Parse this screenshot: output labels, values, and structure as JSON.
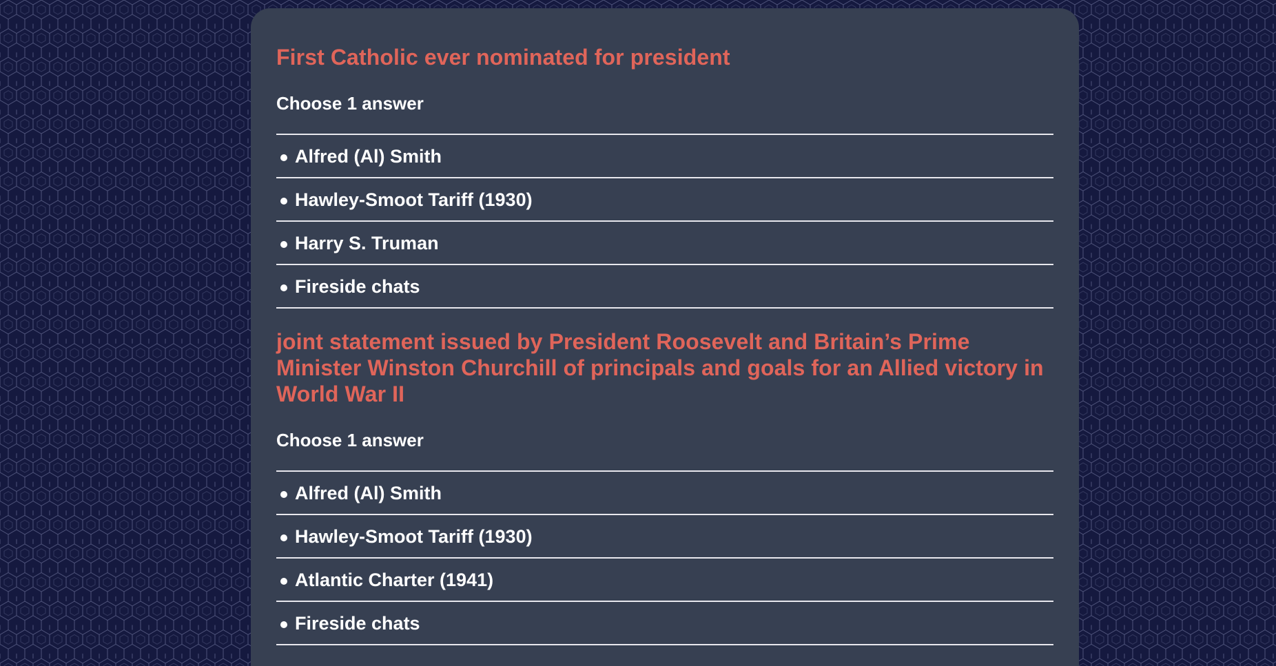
{
  "colors": {
    "page_background": "#15193f",
    "pattern_stroke": "#8a8fb8",
    "card_background": "#374052",
    "question_text": "#e0655a",
    "option_text": "#ffffff",
    "divider": "#e8e8ee"
  },
  "questions": [
    {
      "title": "First Catholic ever nominated for president",
      "instruction": "Choose 1 answer",
      "options": [
        "Alfred (Al) Smith",
        "Hawley-Smoot Tariff (1930)",
        "Harry S. Truman",
        "Fireside chats"
      ]
    },
    {
      "title": "joint statement issued by President Roosevelt and Britain’s Prime Minister Winston Churchill of principals and goals for an Allied victory in World War II",
      "instruction": "Choose 1 answer",
      "options": [
        "Alfred (Al) Smith",
        "Hawley-Smoot Tariff (1930)",
        "Atlantic Charter (1941)",
        "Fireside chats"
      ]
    }
  ]
}
